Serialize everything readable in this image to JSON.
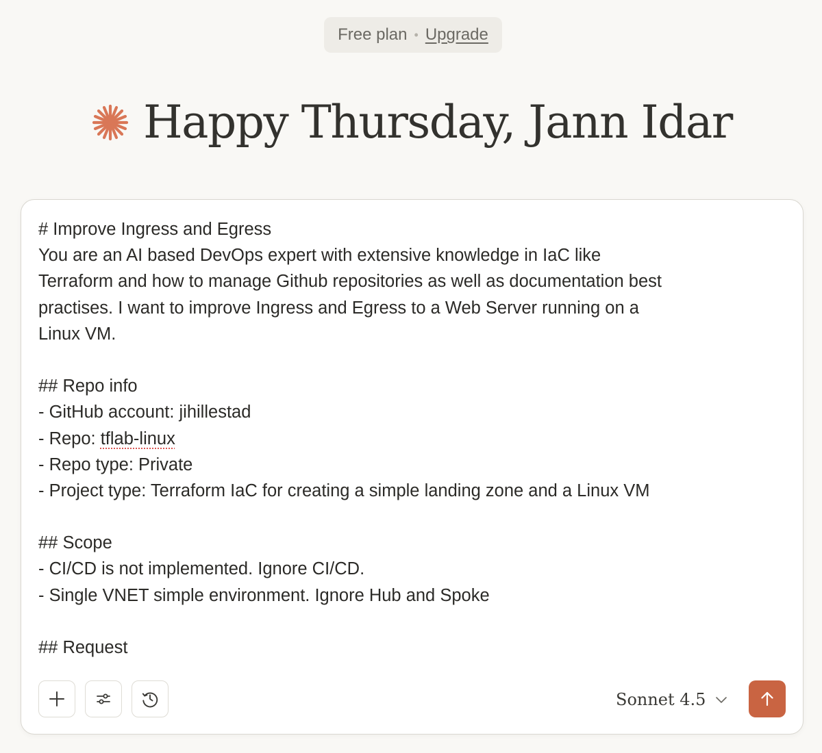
{
  "plan": {
    "label": "Free plan",
    "separator": "•",
    "upgrade_label": "Upgrade"
  },
  "greeting": {
    "title": "Happy Thursday, Jann Idar"
  },
  "composer": {
    "lines": [
      "# Improve Ingress and Egress",
      "You are an AI based DevOps expert with extensive knowledge in IaC like",
      "Terraform and how to manage Github repositories as well as documentation best",
      "practises. I want to improve Ingress and Egress to a Web Server running on a",
      "Linux VM.",
      "",
      "## Repo info",
      "- GitHub account: jihillestad",
      "- Repo: ",
      "tflab-linux",
      "- Repo type: Private",
      "- Project type: Terraform IaC for creating a simple landing zone and a Linux VM",
      "",
      "## Scope",
      "- CI/CD is not implemented. Ignore CI/CD.",
      "- Single VNET simple environment. Ignore Hub and Spoke",
      "",
      "## Request"
    ],
    "model_label": "Sonnet 4.5"
  },
  "icons": {
    "spark": "claude-spark-icon",
    "add": "plus-icon",
    "tools": "sliders-icon",
    "history": "clock-history-icon",
    "chevron": "chevron-down-icon",
    "send": "arrow-up-icon"
  },
  "colors": {
    "accent": "#c96442",
    "spark": "#d97757",
    "background": "#f9f8f5"
  }
}
